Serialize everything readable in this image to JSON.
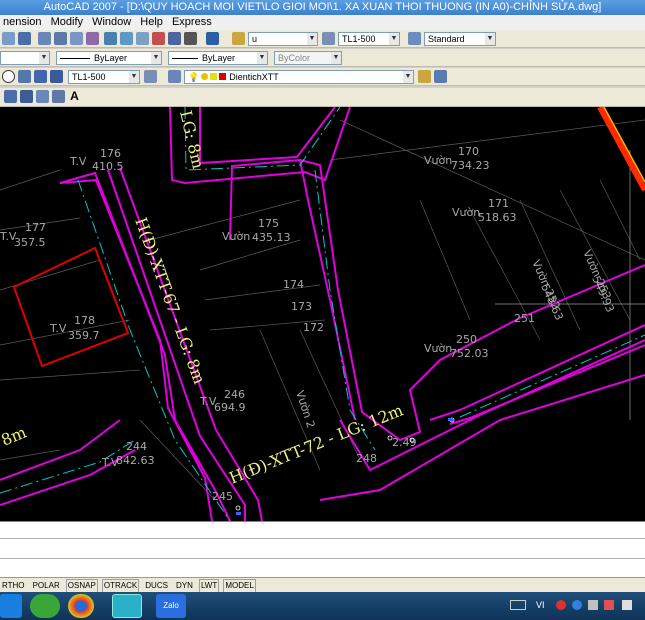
{
  "window": {
    "title": "AutoCAD 2007 - [D:\\QUY HOACH MOI VIET\\LO GIOI MOI\\1. XA XUAN THOI THUONG (IN A0)-CHỈNH SỬA.dwg]"
  },
  "menu": [
    "nension",
    "Modify",
    "Window",
    "Help",
    "Express"
  ],
  "toolbar1": {
    "text_style": "u",
    "dim_style": "TL1-500",
    "table_style": "Standard"
  },
  "toolbar2": {
    "linetype": "ByLayer",
    "lineweight": "ByLayer",
    "plotstyle": "ByColor"
  },
  "toolbar3": {
    "scale": "TL1-500",
    "layer": "DientichXTT"
  },
  "toolbar4": {
    "text_icon": "A"
  },
  "drawing": {
    "labels": [
      {
        "id": "road-top",
        "text": "LG: 8m"
      },
      {
        "id": "road-vertical",
        "text": "H(Đ)-XTT-67 - LG: 8m"
      },
      {
        "id": "road-bottom",
        "text": "H(Đ)-XTT-72 - LG: 12m"
      },
      {
        "id": "road-left",
        "text": "8m"
      },
      {
        "id": "tv176-a",
        "text": "T.V"
      },
      {
        "id": "tv176-n",
        "text": "176"
      },
      {
        "id": "tv176-v",
        "text": "410.5"
      },
      {
        "id": "tv177-a",
        "text": "T.V"
      },
      {
        "id": "tv177-n",
        "text": "177"
      },
      {
        "id": "tv177-v",
        "text": "357.5"
      },
      {
        "id": "tv178-a",
        "text": "T.V"
      },
      {
        "id": "tv178-n",
        "text": "178"
      },
      {
        "id": "tv178-v",
        "text": "359.7"
      },
      {
        "id": "v175-a",
        "text": "Vườn"
      },
      {
        "id": "v175-n",
        "text": "175"
      },
      {
        "id": "v175-v",
        "text": "435.13"
      },
      {
        "id": "v170-a",
        "text": "Vườn"
      },
      {
        "id": "v170-n",
        "text": "170"
      },
      {
        "id": "v170-v",
        "text": "734.23"
      },
      {
        "id": "v171-a",
        "text": "Vườn"
      },
      {
        "id": "v171-n",
        "text": "171"
      },
      {
        "id": "v171-v",
        "text": "518.63"
      },
      {
        "id": "p174",
        "text": "174"
      },
      {
        "id": "p173",
        "text": "173"
      },
      {
        "id": "p172",
        "text": "172"
      },
      {
        "id": "v250-a",
        "text": "Vườn"
      },
      {
        "id": "v250-n",
        "text": "250"
      },
      {
        "id": "v250-v",
        "text": "752.03"
      },
      {
        "id": "p251",
        "text": "251"
      },
      {
        "id": "v252",
        "text": "Vườn 252"
      },
      {
        "id": "v252-v",
        "text": "548.63"
      },
      {
        "id": "v253",
        "text": "Vườn 253"
      },
      {
        "id": "v253-v",
        "text": "549.93"
      },
      {
        "id": "tv246-a",
        "text": "T.V"
      },
      {
        "id": "tv246-n",
        "text": "246"
      },
      {
        "id": "tv246-v",
        "text": "694.9"
      },
      {
        "id": "tv244-a",
        "text": "T.V"
      },
      {
        "id": "tv244-n",
        "text": "244"
      },
      {
        "id": "tv244-v",
        "text": "842.63"
      },
      {
        "id": "v247",
        "text": "Vườn 2"
      },
      {
        "id": "p248",
        "text": "248"
      },
      {
        "id": "p249",
        "text": "2.49"
      },
      {
        "id": "p245",
        "text": "245"
      }
    ]
  },
  "statusbar": [
    "RTHO",
    "POLAR",
    "OSNAP",
    "OTRACK",
    "DUCS",
    "DYN",
    "LWT",
    "MODEL"
  ],
  "taskbar": {
    "app_badge": "Zalo",
    "tray_text": "VI"
  }
}
